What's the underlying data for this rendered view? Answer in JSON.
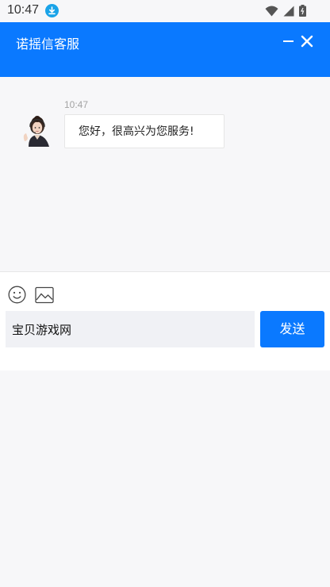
{
  "status_bar": {
    "time": "10:47"
  },
  "header": {
    "title": "诺摇信客服"
  },
  "chat": {
    "messages": [
      {
        "time": "10:47",
        "text": "您好，很高兴为您服务!"
      }
    ]
  },
  "input": {
    "value": "宝贝游戏网",
    "send_label": "发送"
  },
  "colors": {
    "accent": "#0a79ff",
    "input_bg": "#f0f1f5",
    "background": "#f7f7f9"
  },
  "icons": [
    "download-icon",
    "wifi-icon",
    "signal-icon",
    "battery-icon",
    "minimize-icon",
    "close-icon",
    "emoji-icon",
    "image-icon"
  ]
}
